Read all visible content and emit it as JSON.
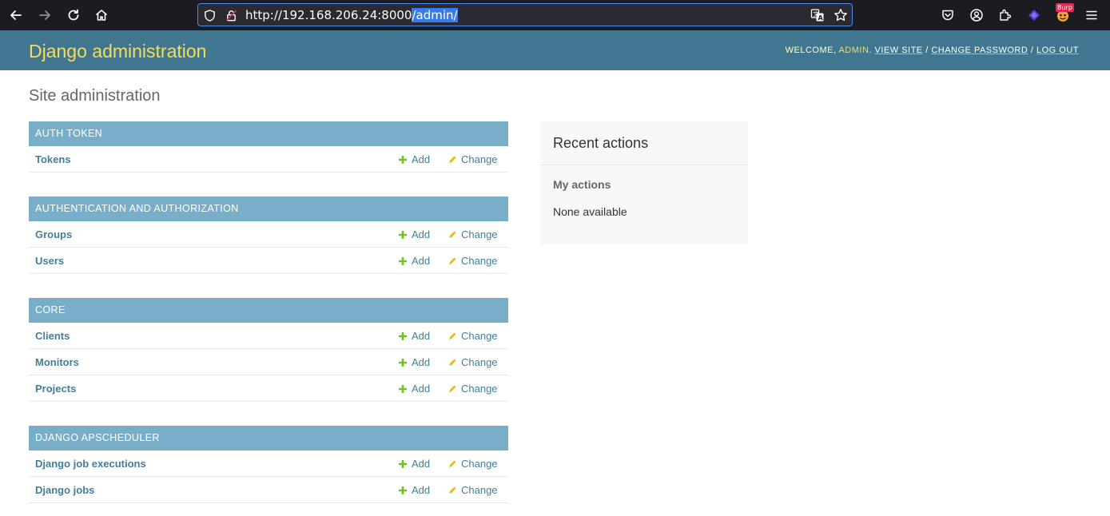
{
  "browser": {
    "url_base": "http://192.168.206.24:8000",
    "url_path": "/admin/",
    "burp_badge": "Burp"
  },
  "header": {
    "brand": "Django administration",
    "welcome": "WELCOME, ",
    "username": "ADMIN",
    "period": ". ",
    "view_site": "VIEW SITE",
    "sep": " / ",
    "change_password": "CHANGE PASSWORD",
    "log_out": "LOG OUT"
  },
  "page": {
    "title": "Site administration"
  },
  "labels": {
    "add": "Add",
    "change": "Change"
  },
  "modules": [
    {
      "caption": "AUTH TOKEN",
      "models": [
        {
          "name": "Tokens"
        }
      ]
    },
    {
      "caption": "AUTHENTICATION AND AUTHORIZATION",
      "models": [
        {
          "name": "Groups"
        },
        {
          "name": "Users"
        }
      ]
    },
    {
      "caption": "CORE",
      "models": [
        {
          "name": "Clients"
        },
        {
          "name": "Monitors"
        },
        {
          "name": "Projects"
        }
      ]
    },
    {
      "caption": "DJANGO APSCHEDULER",
      "models": [
        {
          "name": "Django job executions"
        },
        {
          "name": "Django jobs"
        }
      ]
    }
  ],
  "recent_actions": {
    "title": "Recent actions",
    "subtitle": "My actions",
    "empty": "None available"
  },
  "colors": {
    "header_bg": "#417690",
    "brand": "#f5dd5d",
    "caption_bg": "#79aec8",
    "link": "#447e9b",
    "add_icon": "#70bf2b",
    "change_icon": "#efb80b"
  }
}
